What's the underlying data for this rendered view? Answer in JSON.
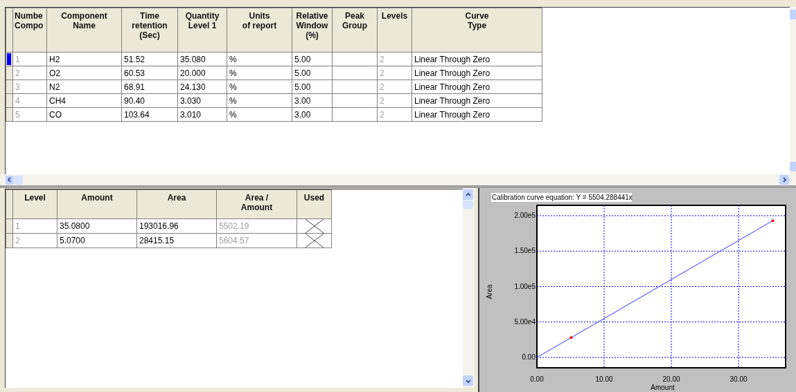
{
  "components_table": {
    "columns": [
      "Numbe\nCompo",
      "Component\nName",
      "Time\nretention\n(Sec)",
      "Quantity\nLevel 1",
      "Units\nof report",
      "Relative\nWindow\n(%)",
      "Peak\nGroup",
      "Levels",
      "Curve\nType"
    ],
    "rows": [
      {
        "selected": true,
        "cells": [
          "1",
          "H2",
          "51.52",
          "35.080",
          "%",
          "5.00",
          "",
          "2",
          "Linear Through Zero"
        ]
      },
      {
        "selected": false,
        "cells": [
          "2",
          "O2",
          "60.53",
          "20.000",
          "%",
          "5.00",
          "",
          "2",
          "Linear Through Zero"
        ]
      },
      {
        "selected": false,
        "cells": [
          "3",
          "N2",
          "68.91",
          "24.130",
          "%",
          "5.00",
          "",
          "2",
          "Linear Through Zero"
        ]
      },
      {
        "selected": false,
        "cells": [
          "4",
          "CH4",
          "90.40",
          "3.030",
          "%",
          "3.00",
          "",
          "2",
          "Linear Through Zero"
        ]
      },
      {
        "selected": false,
        "cells": [
          "5",
          "CO",
          "103.64",
          "3.010",
          "%",
          "3.00",
          "",
          "2",
          "Linear Through Zero"
        ]
      }
    ]
  },
  "levels_table": {
    "columns": [
      "Level",
      "Amount",
      "Area",
      "Area /\nAmount",
      "Used"
    ],
    "rows": [
      {
        "cells": [
          "1",
          "35.0800",
          "193016.96",
          "5502.19"
        ],
        "crossed": true
      },
      {
        "cells": [
          "2",
          "5.0700",
          "28415.15",
          "5604.57"
        ],
        "crossed": true
      }
    ]
  },
  "calibration_chart": {
    "chart_data": {
      "type": "line",
      "title": "Calibration curve equation: Y = 5504.288441x",
      "xlabel": "Amount",
      "ylabel": "Area",
      "x": [
        0,
        5.1,
        35.1
      ],
      "grid": true,
      "series": [
        {
          "color": "#3030ff",
          "values": [
            0,
            28000,
            193000
          ]
        }
      ],
      "xlim": [
        0,
        37
      ],
      "ylim": [
        -14600,
        214600
      ],
      "xticks": [
        {
          "value": 0,
          "label": "0.00"
        },
        {
          "value": 10,
          "label": "10.00"
        },
        {
          "value": 20,
          "label": "20.00"
        },
        {
          "value": 30,
          "label": "30.00"
        }
      ],
      "yticks": [
        {
          "value": 0,
          "label": "0.00"
        },
        {
          "value": 50000,
          "label": "5.00e4"
        },
        {
          "value": 100000,
          "label": "1.00e5"
        },
        {
          "value": 150000,
          "label": "1.50e5"
        },
        {
          "value": 200000,
          "label": "2.00e5"
        }
      ]
    }
  }
}
